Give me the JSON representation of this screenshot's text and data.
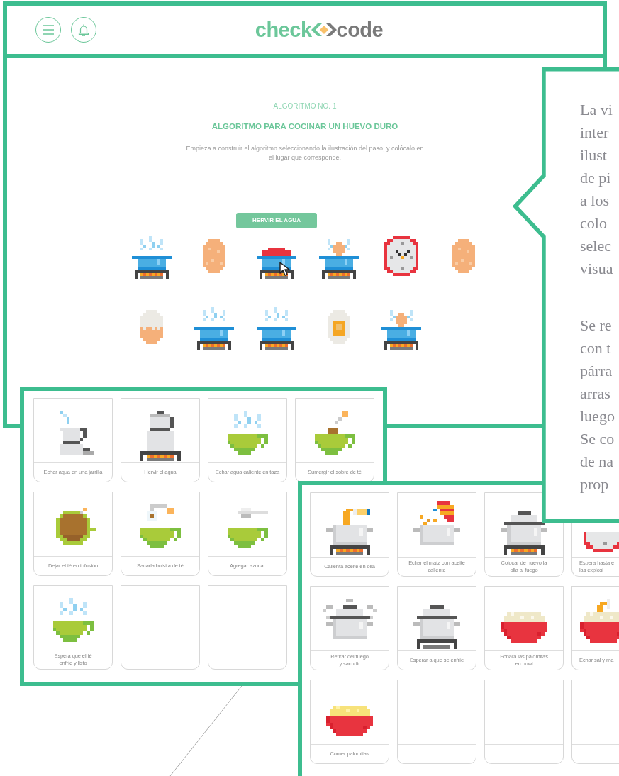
{
  "header": {
    "logo": {
      "left": "check",
      "right": "code"
    }
  },
  "algorithm": {
    "number": "ALGORITMO NO. 1",
    "title": "ALGORITMO PARA COCINAR UN HUEVO DURO",
    "instructions": "Empieza a construir el algoritmo seleccionando la ilustración del paso, y colócalo en el lugar que corresponde.",
    "steps": [
      {
        "kind": "pot-steam",
        "hovered": false
      },
      {
        "kind": "egg",
        "hovered": false
      },
      {
        "kind": "pot-lid",
        "hovered": true,
        "tooltip": "HERVIR EL AGUA"
      },
      {
        "kind": "pot-egg",
        "hovered": false
      },
      {
        "kind": "clock",
        "hovered": false
      },
      {
        "kind": "egg",
        "hovered": false
      },
      {
        "kind": "egg-cracked",
        "hovered": false
      },
      {
        "kind": "pot-steam",
        "hovered": false
      },
      {
        "kind": "pot-steam",
        "hovered": false
      },
      {
        "kind": "egg-halved",
        "hovered": false
      },
      {
        "kind": "pot-egg",
        "hovered": false
      }
    ]
  },
  "description": {
    "paragraphs": [
      [
        "La vi",
        "inter",
        "ilust",
        "de pi",
        "a los",
        "colo",
        "selec",
        "visua"
      ],
      [
        "Se re",
        "con t",
        "párra",
        "arras",
        "luego",
        "Se co",
        "de na",
        "prop"
      ]
    ]
  },
  "tea_board": {
    "rows": [
      [
        {
          "kind": "jug-pour",
          "label": "Echar agua en una jarrilla"
        },
        {
          "kind": "kettle-stove",
          "label": "Hervir el agua"
        },
        {
          "kind": "cup-steam",
          "label": "Echar agua caliente en taza"
        },
        {
          "kind": "cup-teabag",
          "label": "Sumergir el sobre de té"
        }
      ],
      [
        {
          "kind": "tea-infusion",
          "label": "Dejar el té en infusión"
        },
        {
          "kind": "cup-bag-out",
          "label": "Sacarla bolsita de té"
        },
        {
          "kind": "cup-spoon",
          "label": "Agregar azucar"
        }
      ],
      [
        {
          "kind": "cup-steam",
          "label": "Espera que el té\nenfríe y listo"
        },
        {
          "kind": "blank"
        },
        {
          "kind": "blank"
        }
      ]
    ]
  },
  "popcorn_board": {
    "cards": [
      {
        "kind": "pot-oil",
        "label": "Calienta aceite en olla"
      },
      {
        "kind": "corn-pour",
        "label": "Echar el maíz con aceite\ncaliente"
      },
      {
        "kind": "pot-lid-stove",
        "label": "Colocar de nuevo la\nolla al fuego"
      },
      {
        "kind": "clock",
        "label": "Espera hasta e\nlas explosi"
      },
      {
        "kind": "pot-shake",
        "label": "Retirar del fuego\ny sacudir"
      },
      {
        "kind": "pot-cool",
        "label": "Esperar a que se enfríe"
      },
      {
        "kind": "bowl-popcorn",
        "label": "Echara las palomitas\nen bowl"
      },
      {
        "kind": "bowl-salt",
        "label": "Echar sal y ma"
      },
      {
        "kind": "bowl-popcorn-yellow",
        "label": "Comer palomitas"
      },
      {
        "kind": "blank"
      },
      {
        "kind": "blank"
      },
      {
        "kind": "blank"
      }
    ]
  }
}
